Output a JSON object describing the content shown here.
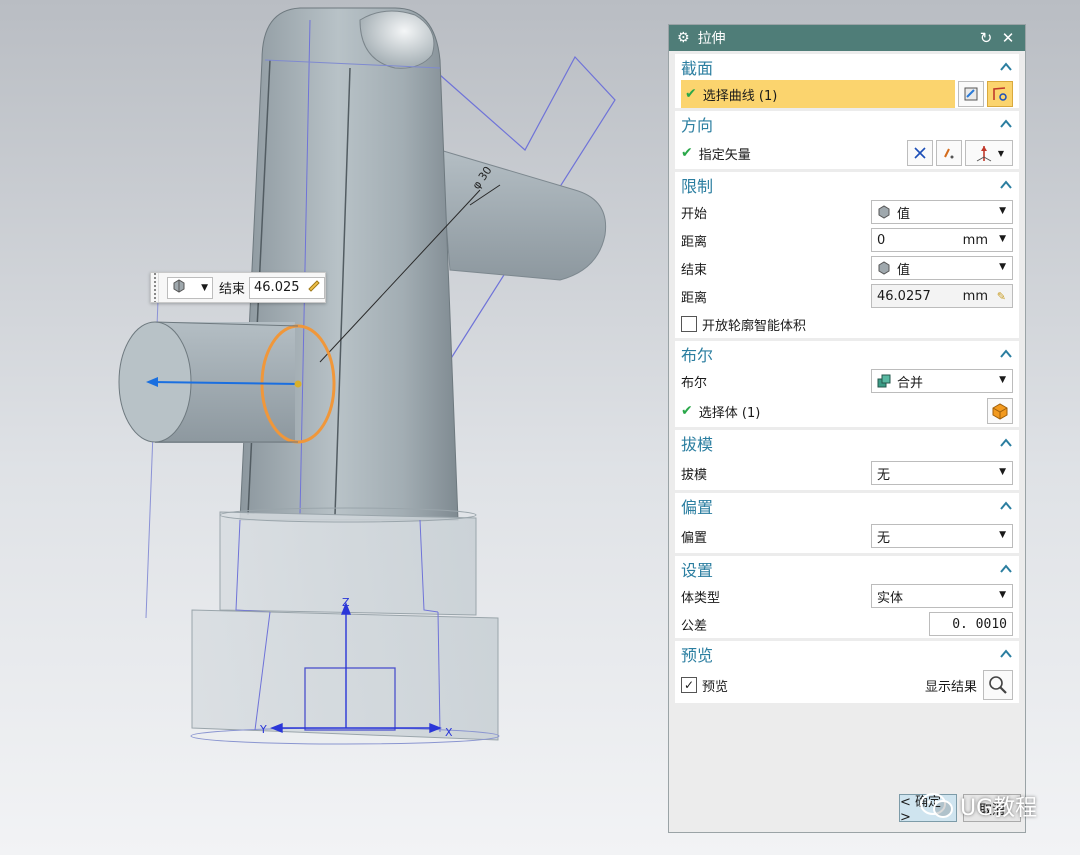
{
  "float_input": {
    "end_label": "结束",
    "end_value": "46.025"
  },
  "dialog": {
    "title": "拉伸",
    "sections": {
      "section": {
        "title": "截面",
        "select_curve": "选择曲线 (1)"
      },
      "direction": {
        "title": "方向",
        "specify_vector": "指定矢量"
      },
      "limits": {
        "title": "限制",
        "start_label": "开始",
        "start_option": "值",
        "distance1_label": "距离",
        "distance1_value": "0",
        "distance1_unit": "mm",
        "end_label": "结束",
        "end_option": "值",
        "distance2_label": "距离",
        "distance2_value": "46.0257",
        "distance2_unit": "mm",
        "open_profile_label": "开放轮廓智能体积"
      },
      "boolean": {
        "title": "布尔",
        "boolean_label": "布尔",
        "boolean_option": "合并",
        "select_body": "选择体 (1)"
      },
      "draft": {
        "title": "拔模",
        "draft_label": "拔模",
        "draft_option": "无"
      },
      "offset": {
        "title": "偏置",
        "offset_label": "偏置",
        "offset_option": "无"
      },
      "settings": {
        "title": "设置",
        "body_type_label": "体类型",
        "body_type_option": "实体",
        "tolerance_label": "公差",
        "tolerance_value": "0. 0010"
      },
      "preview": {
        "title": "预览",
        "preview_label": "预览",
        "show_result_label": "显示结果"
      }
    },
    "buttons": {
      "ok_label": "< 确定 >",
      "cancel_label": "取消"
    }
  },
  "viewport": {
    "dimension_label": "φ 30",
    "axis_x": "X",
    "axis_y": "Y",
    "axis_z": "Z"
  },
  "watermark": {
    "text": "UG教程"
  },
  "colors": {
    "title_bar": "#4f7d78",
    "section_title": "#2b7ea0",
    "highlight": "#fbd46e",
    "check": "#2aa84a",
    "selected_edge": "#f0973a"
  }
}
